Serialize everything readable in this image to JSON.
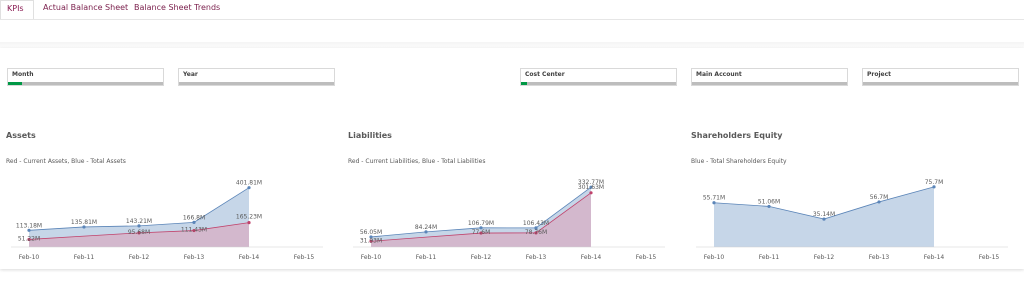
{
  "tabs": [
    {
      "label": "KPIs",
      "active": true
    },
    {
      "label": "Actual Balance Sheet",
      "active": false
    },
    {
      "label": "Balance Sheet Trends",
      "active": false
    }
  ],
  "filters": [
    {
      "label": "Month",
      "selected_fraction": 0.09
    },
    {
      "label": "Year",
      "selected_fraction": 0
    },
    {
      "label": "Cost Center",
      "selected_fraction": 0.04
    },
    {
      "label": "Main Account",
      "selected_fraction": 0
    },
    {
      "label": "Project",
      "selected_fraction": 0
    }
  ],
  "colors": {
    "blue_series": "#c6d6e8",
    "blue_line": "#5b85b8",
    "red_series": "#d5b3c8",
    "red_line": "#c0426b",
    "filter_green": "#009845"
  },
  "charts": [
    {
      "title": "Assets",
      "subtitle": "Red - Current Assets, Blue - Total Assets",
      "chart_data": {
        "type": "area",
        "categories": [
          "Feb-10",
          "Feb-11",
          "Feb-12",
          "Feb-13",
          "Feb-14",
          "Feb-15"
        ],
        "series": [
          {
            "values": [
              113.18,
              135.81,
              143.21,
              166.8,
              401.81,
              null
            ],
            "labels": [
              "113.18M",
              "135.81M",
              "143.21M",
              "166.8M",
              "401.81M",
              ""
            ],
            "color": "blue"
          },
          {
            "values": [
              51.22,
              null,
              95.68,
              111.43,
              165.23,
              null
            ],
            "labels": [
              "51.22M",
              "",
              "95.68M",
              "111.43M",
              "165.23M",
              ""
            ],
            "color": "red"
          }
        ],
        "ylim": [
          0,
          420
        ]
      }
    },
    {
      "title": "Liabilities",
      "subtitle": "Red - Current Liabilities, Blue - Total Liabilities",
      "chart_data": {
        "type": "area",
        "categories": [
          "Feb-10",
          "Feb-11",
          "Feb-12",
          "Feb-13",
          "Feb-14",
          "Feb-15"
        ],
        "series": [
          {
            "values": [
              56.05,
              84.24,
              106.79,
              106.43,
              332.77,
              null
            ],
            "labels": [
              "56.05M",
              "84.24M",
              "106.79M",
              "106.43M",
              "332.77M",
              ""
            ],
            "color": "blue"
          },
          {
            "values": [
              31.93,
              null,
              77.6,
              78.76,
              301.63,
              null
            ],
            "labels": [
              "31.93M",
              "",
              "77.6M",
              "78.76M",
              "301.63M",
              ""
            ],
            "color": "red"
          }
        ],
        "ylim": [
          0,
          345
        ]
      }
    },
    {
      "title": "Shareholders Equity",
      "subtitle": "Blue - Total Shareholders Equity",
      "chart_data": {
        "type": "area",
        "categories": [
          "Feb-10",
          "Feb-11",
          "Feb-12",
          "Feb-13",
          "Feb-14",
          "Feb-15"
        ],
        "series": [
          {
            "values": [
              55.71,
              51.06,
              35.14,
              56.7,
              75.7,
              null
            ],
            "labels": [
              "55.71M",
              "51.06M",
              "35.14M",
              "56.7M",
              "75.7M",
              ""
            ],
            "color": "blue"
          }
        ],
        "ylim": [
          0,
          78
        ]
      }
    }
  ]
}
